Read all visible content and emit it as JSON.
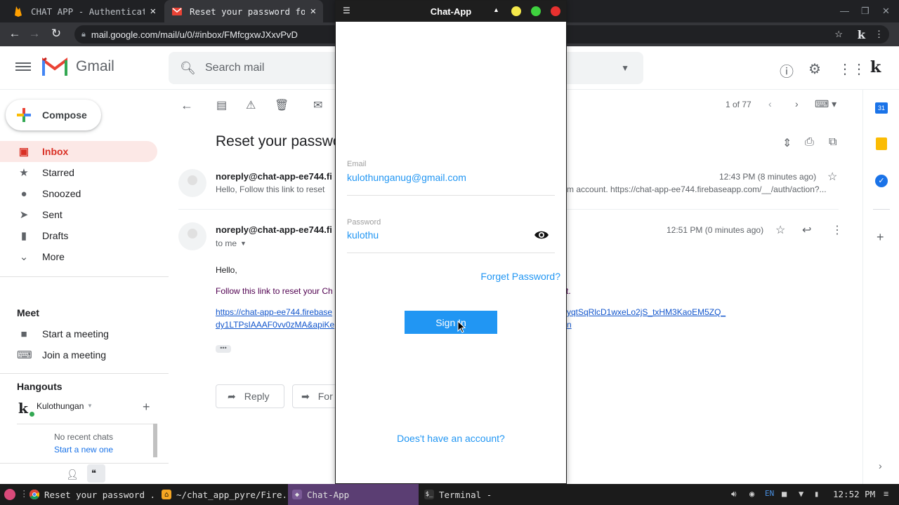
{
  "browser": {
    "tabs": [
      {
        "title": "CHAT APP - Authenticati",
        "active": false
      },
      {
        "title": "Reset your password fo",
        "active": true
      }
    ],
    "url": "mail.google.com/mail/u/0/#inbox/FMfcgxwJXxvPvD"
  },
  "gmail": {
    "brand": "Gmail",
    "search_placeholder": "Search mail",
    "profile_initial": "k",
    "compose": "Compose",
    "nav": [
      {
        "label": "Inbox",
        "icon": "inbox-icon",
        "active": true
      },
      {
        "label": "Starred",
        "icon": "star-icon",
        "active": false
      },
      {
        "label": "Snoozed",
        "icon": "clock-icon",
        "active": false
      },
      {
        "label": "Sent",
        "icon": "send-icon",
        "active": false
      },
      {
        "label": "Drafts",
        "icon": "draft-icon",
        "active": false
      },
      {
        "label": "More",
        "icon": "chevron-down-icon",
        "active": false
      }
    ],
    "meet": {
      "title": "Meet",
      "items": [
        {
          "label": "Start a meeting",
          "icon": "video-icon"
        },
        {
          "label": "Join a meeting",
          "icon": "keyboard-icon"
        }
      ]
    },
    "hangouts": {
      "title": "Hangouts",
      "user": "Kulothungan",
      "no_chats": "No recent chats",
      "start_new": "Start a new one"
    },
    "pagination": "1 of 77",
    "subject": "Reset your passwo",
    "messages": [
      {
        "sender": "noreply@chat-app-ee744.fi",
        "time": "12:43 PM (8 minutes ago)",
        "snippet_left": "Hello, Follow this link to reset",
        "snippet_right": "m account. https://chat-app-ee744.firebaseapp.com/__/auth/action?..."
      },
      {
        "sender": "noreply@chat-app-ee744.fi",
        "time": "12:51 PM (0 minutes ago)",
        "to": "to me",
        "greeting": "Hello,",
        "body_line": "Follow this link to reset your Ch",
        "body_line_tail": "t.",
        "link_left_1": "https://chat-app-ee744.firebase",
        "link_left_2": "dy1LTPsIAAAF0vv0zMA&apiKe",
        "link_right_1": "yqtSqRlcD1wxeLo2jS_txHM3KaoEM5ZQ_",
        "link_right_2": "n"
      }
    ],
    "reply": "Reply",
    "forward": "For"
  },
  "chatapp": {
    "title": "Chat-App",
    "email_label": "Email",
    "email_value": "kulothunganug@gmail.com",
    "password_label": "Password",
    "password_value": "kulothu",
    "forgot": "Forget Password?",
    "signin": "Sign In",
    "signup": "Does't have an account?"
  },
  "taskbar": {
    "tasks": [
      {
        "label": "Reset your password ..."
      },
      {
        "label": "~/chat_app_pyre/Fire..."
      },
      {
        "label": "Chat-App"
      },
      {
        "label": "Terminal -"
      }
    ],
    "lang": "EN",
    "clock": "12:52 PM"
  },
  "colors": {
    "gmail_red": "#d93025",
    "accent_blue": "#2196f3",
    "taskbar_active": "#5b3e73"
  }
}
